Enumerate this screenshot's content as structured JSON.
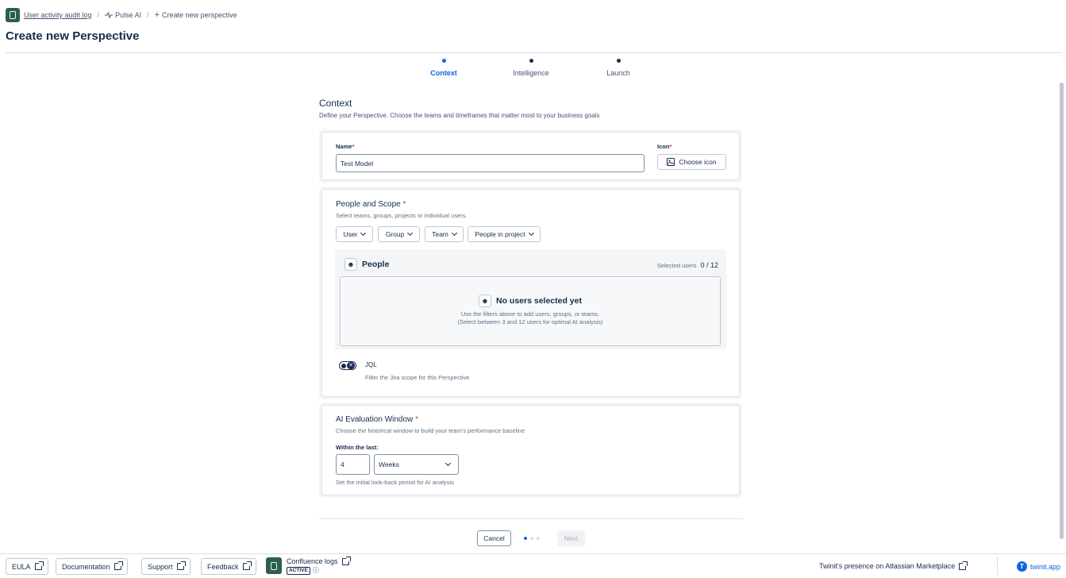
{
  "breadcrumb": {
    "app_link": "User activity audit log",
    "separator": "/",
    "item2": "Pulse AI",
    "item3": "Create new perspective"
  },
  "page_title": "Create new Perspective",
  "stepper": [
    {
      "label": "Context",
      "active": true
    },
    {
      "label": "Intelligence",
      "active": false
    },
    {
      "label": "Launch",
      "active": false
    }
  ],
  "section": {
    "title": "Context",
    "description": "Define your Perspective. Choose the teams and timeframes that matter most to your business goals"
  },
  "name_card": {
    "name_label": "Name",
    "name_value": "Test Model",
    "icon_label": "Icon",
    "required_mark": "*",
    "choose_icon_label": "Choose icon"
  },
  "scope_card": {
    "title": "People and Scope",
    "subtitle": "Select teams, groups, projects or individual users.",
    "filters": [
      "User",
      "Group",
      "Team",
      "People in project"
    ],
    "people_title": "People",
    "selected_label": "Selected users",
    "selected_value": "0 / 12",
    "empty_title": "No users selected yet",
    "empty_line1": "Use the filters above to add users, groups, or teams.",
    "empty_line2": "(Select between 3 and 12 users for optimal AI analysis)",
    "jql_label": "JQL",
    "jql_desc": "Filter the Jira scope for this Perspective",
    "jql_enabled": false
  },
  "window_card": {
    "title": "AI Evaluation Window",
    "subtitle": "Choose the historical window to build your team's performance baseline",
    "within_label": "Within the last:",
    "amount": "4",
    "unit": "Weeks",
    "help": "Set the initial look-back period for AI analysis"
  },
  "actions": {
    "cancel": "Cancel",
    "next": "Next",
    "page_current": 1,
    "page_total": 3
  },
  "footer": {
    "eula": "EULA",
    "documentation": "Documentation",
    "support": "Support",
    "feedback": "Feedback",
    "app_name": "Confluence logs",
    "app_status": "ACTIVE",
    "marketplace": "Twinit's presence on Atlassian Marketplace",
    "brand": "twinit.app"
  },
  "colors": {
    "accent": "#0c66e4",
    "text": "#172b4d",
    "required": "#c9372c",
    "brand_logo": "#2e5e4e"
  }
}
